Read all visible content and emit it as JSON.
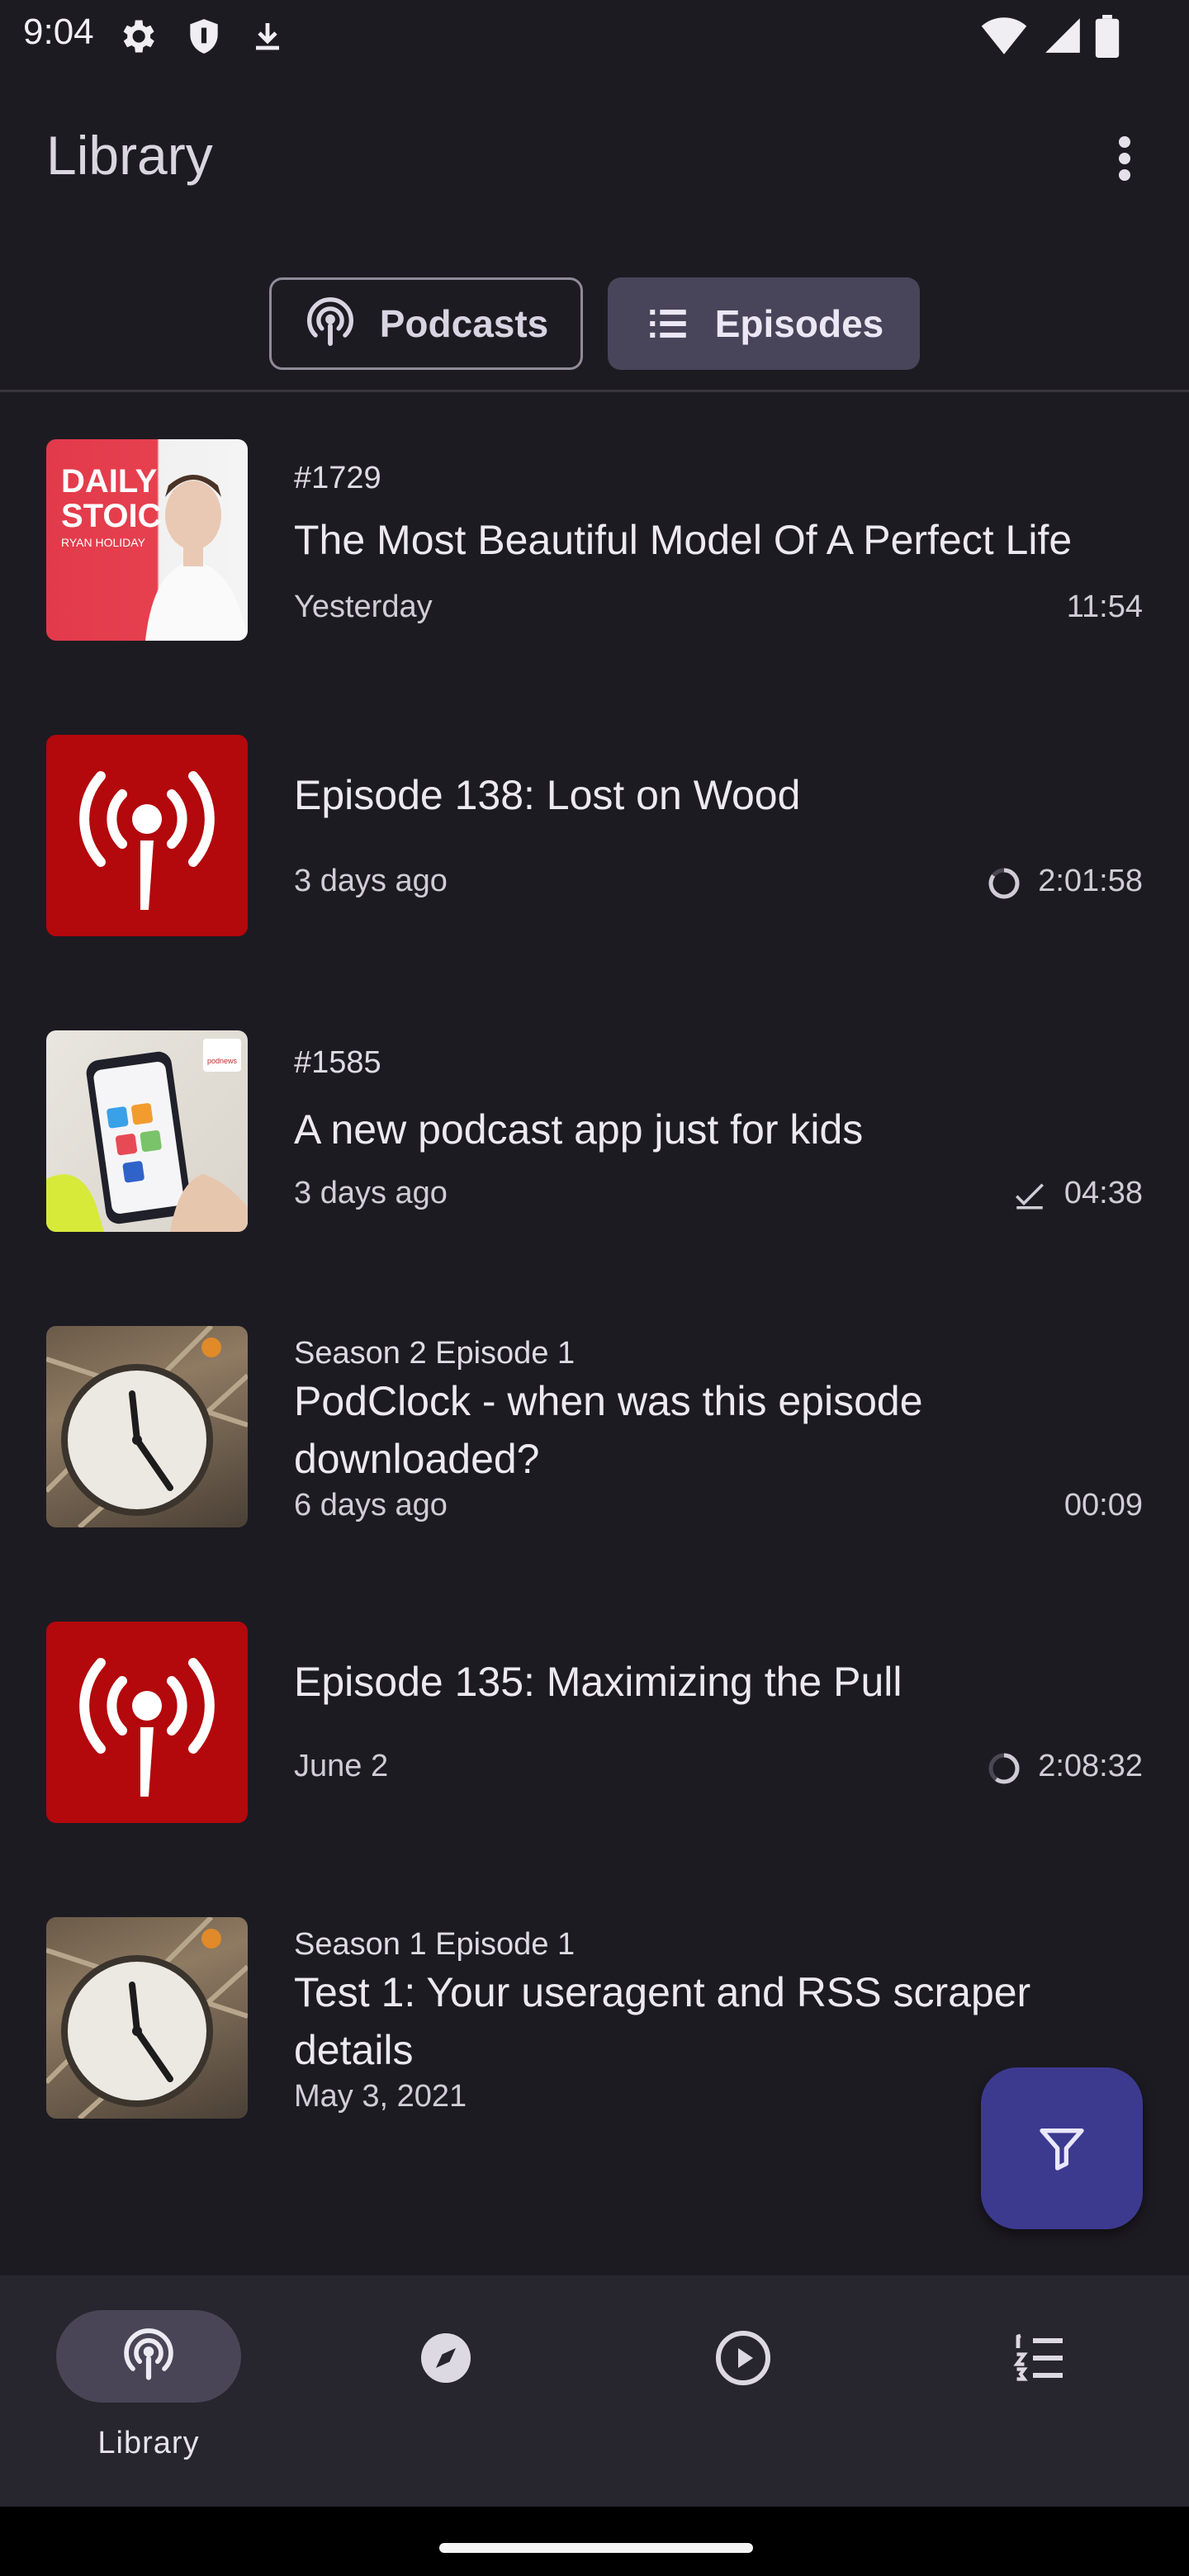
{
  "status_bar": {
    "time": "9:04"
  },
  "app_bar": {
    "title": "Library"
  },
  "segments": [
    {
      "label": "Podcasts",
      "icon": "podcast-icon",
      "selected": false
    },
    {
      "label": "Episodes",
      "icon": "list-icon",
      "selected": true
    }
  ],
  "episodes": [
    {
      "number": "#1729",
      "title": "The Most Beautiful Model Of A Perfect Life",
      "date": "Yesterday",
      "duration": "11:54",
      "status": "none",
      "artwork": "daily-stoic"
    },
    {
      "number": "",
      "title": "Episode 138: Lost on Wood",
      "date": "3 days ago",
      "duration": "2:01:58",
      "status": "progress",
      "progress": 0.85,
      "artwork": "red-broadcast"
    },
    {
      "number": "#1585",
      "title": "A new podcast app just for kids",
      "date": "3 days ago",
      "duration": "04:38",
      "status": "played",
      "artwork": "podnews"
    },
    {
      "number": "Season 2 Episode 1",
      "title": "PodClock - when was this episode downloaded?",
      "date": "6 days ago",
      "duration": "00:09",
      "status": "none",
      "artwork": "clock"
    },
    {
      "number": "",
      "title": "Episode 135: Maximizing the Pull",
      "date": "June 2",
      "duration": "2:08:32",
      "status": "progress",
      "progress": 0.6,
      "artwork": "red-broadcast"
    },
    {
      "number": "Season 1 Episode 1",
      "title": "Test 1: Your useragent and RSS scraper details",
      "date": "May 3, 2021",
      "duration": "",
      "status": "none",
      "artwork": "clock"
    }
  ],
  "artwork_text": {
    "daily_stoic_line1": "DAILY",
    "daily_stoic_line2": "STOIC",
    "daily_stoic_author": "RYAN HOLIDAY",
    "podnews_logo": "podnews"
  },
  "fab": {
    "icon": "filter-icon"
  },
  "bottom_nav": [
    {
      "label": "Library",
      "icon": "podcast-icon",
      "selected": true
    },
    {
      "label": "",
      "icon": "compass-icon",
      "selected": false
    },
    {
      "label": "",
      "icon": "play-circle-icon",
      "selected": false
    },
    {
      "label": "",
      "icon": "queue-icon",
      "selected": false
    }
  ],
  "colors": {
    "background": "#1d1b22",
    "accent": "#3c3a8f",
    "selected_segment": "#48445a",
    "red_artwork": "#b3080c"
  }
}
